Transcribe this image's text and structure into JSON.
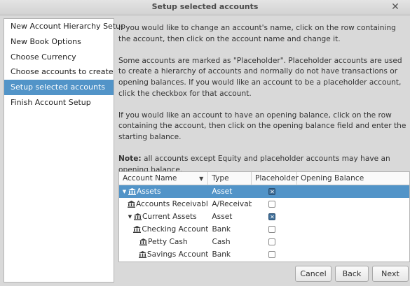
{
  "window": {
    "title": "Setup selected accounts",
    "close_glyph": "✕"
  },
  "sidebar": {
    "items": [
      {
        "label": "New Account Hierarchy Setup",
        "active": false
      },
      {
        "label": "New Book Options",
        "active": false
      },
      {
        "label": "Choose Currency",
        "active": false
      },
      {
        "label": "Choose accounts to create",
        "active": false
      },
      {
        "label": "Setup selected accounts",
        "active": true
      },
      {
        "label": "Finish Account Setup",
        "active": false
      }
    ]
  },
  "instructions": {
    "p1": "If you would like to change an account's name, click on the row containing the account, then click on the account name and change it.",
    "p2": "Some accounts are marked as \"Placeholder\". Placeholder accounts are used to create a hierarchy of accounts and normally do not have transactions or opening balances. If you would like an account to be a placeholder account, click the checkbox for that account.",
    "p3": "If you would like an account to have an opening balance, click on the row containing the account, then click on the opening balance field and enter the starting balance.",
    "note_label": "Note:",
    "note_text": " all accounts except Equity and placeholder accounts may have an opening balance."
  },
  "tree": {
    "columns": {
      "account_name": "Account Name",
      "type": "Type",
      "placeholder": "Placeholder",
      "opening_balance": "Opening Balance"
    },
    "rows": [
      {
        "name": "Assets",
        "type": "Asset",
        "depth": 0,
        "expanded": true,
        "placeholder": true,
        "selected": true
      },
      {
        "name": "Accounts Receivable",
        "type": "A/Receivable",
        "depth": 1,
        "expanded": null,
        "placeholder": false,
        "selected": false
      },
      {
        "name": "Current Assets",
        "type": "Asset",
        "depth": 1,
        "expanded": true,
        "placeholder": true,
        "selected": false
      },
      {
        "name": "Checking Account",
        "type": "Bank",
        "depth": 2,
        "expanded": null,
        "placeholder": false,
        "selected": false
      },
      {
        "name": "Petty Cash",
        "type": "Cash",
        "depth": 2,
        "expanded": null,
        "placeholder": false,
        "selected": false
      },
      {
        "name": "Savings Account",
        "type": "Bank",
        "depth": 2,
        "expanded": null,
        "placeholder": false,
        "selected": false
      }
    ]
  },
  "buttons": {
    "cancel": "Cancel",
    "back": "Back",
    "next": "Next"
  },
  "colors": {
    "selection": "#5294c8",
    "checkbox_checked": "#3f6e98"
  },
  "icons": {
    "account_row": "bank-icon",
    "expander": "triangle-down-icon",
    "sort": "sort-down-icon"
  }
}
